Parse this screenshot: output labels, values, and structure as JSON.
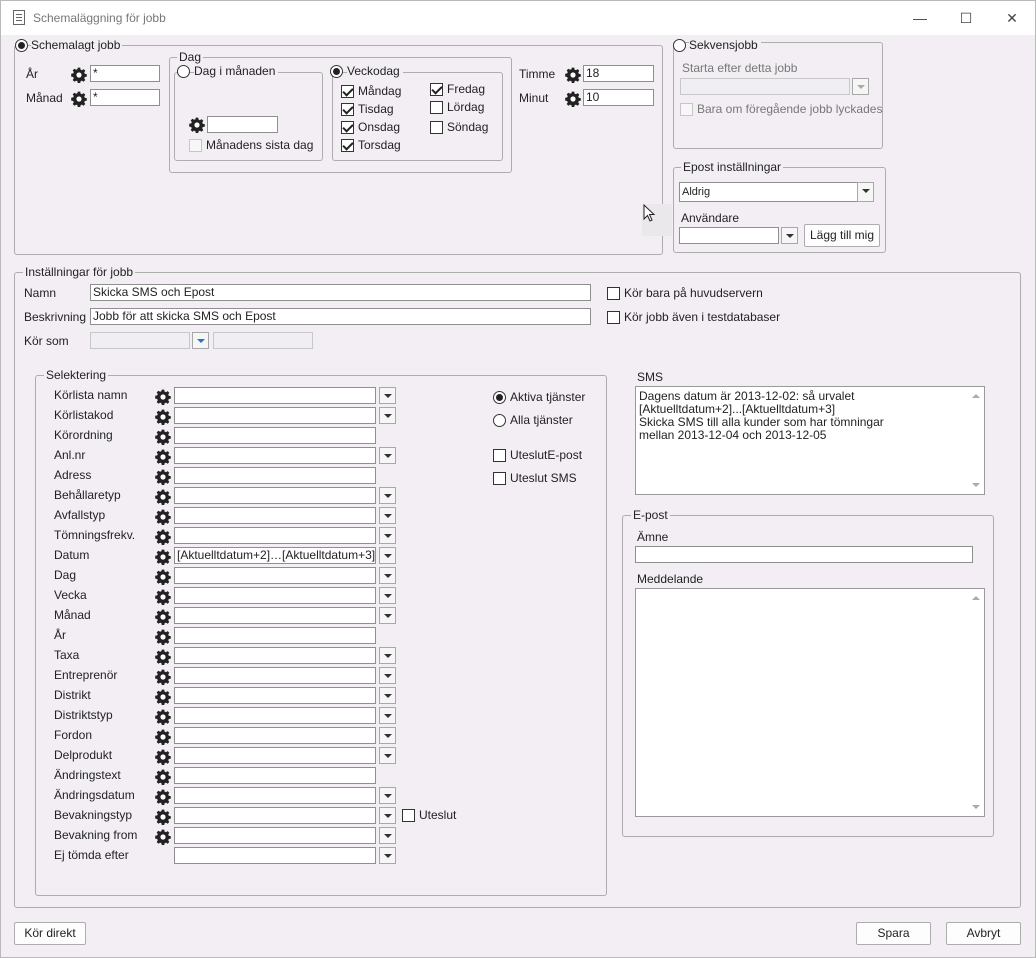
{
  "window": {
    "title": "Schemaläggning för jobb",
    "minimize": "—",
    "maximize": "☐",
    "close": "✕"
  },
  "schedule": {
    "scheduled_label": "Schemalagt jobb",
    "year_label": "År",
    "year_value": "*",
    "month_label": "Månad",
    "month_value": "*",
    "day_group": "Dag",
    "day_of_month_label": "Dag i månaden",
    "day_of_month_value": "",
    "last_day_label": "Månadens sista dag",
    "weekday_label": "Veckodag",
    "days": {
      "mon": "Måndag",
      "tue": "Tisdag",
      "wed": "Onsdag",
      "thu": "Torsdag",
      "fri": "Fredag",
      "sat": "Lördag",
      "sun": "Söndag"
    },
    "hour_label": "Timme",
    "hour_value": "18",
    "minute_label": "Minut",
    "minute_value": "10"
  },
  "sequence": {
    "label": "Sekvensjobb",
    "start_after_label": "Starta efter detta jobb",
    "start_after_value": "",
    "only_if_success_label": "Bara om föregående jobb lyckades"
  },
  "email_settings": {
    "group": "Epost inställningar",
    "send_value": "Aldrig",
    "user_label": "Användare",
    "user_value": "",
    "add_me": "Lägg till mig"
  },
  "job_settings": {
    "group": "Inställningar för jobb",
    "name_label": "Namn",
    "name_value": "Skicka SMS och Epost",
    "desc_label": "Beskrivning",
    "desc_value": "Jobb för att skicka SMS och Epost",
    "run_as_label": "Kör som",
    "run_as_value": "",
    "run_as_extra": "",
    "main_server_only": "Kör bara på huvudservern",
    "run_in_test": "Kör jobb även i testdatabaser"
  },
  "selection": {
    "group": "Selektering",
    "rows": [
      {
        "label": "Körlista namn",
        "value": ""
      },
      {
        "label": "Körlistakod",
        "value": ""
      },
      {
        "label": "Körordning",
        "value": ""
      },
      {
        "label": "Anl.nr",
        "value": ""
      },
      {
        "label": "Adress",
        "value": ""
      },
      {
        "label": "Behållaretyp",
        "value": ""
      },
      {
        "label": "Avfallstyp",
        "value": ""
      },
      {
        "label": "Tömningsfrekv.",
        "value": ""
      },
      {
        "label": "Datum",
        "value": "[Aktuelltdatum+2]…[Aktuelltdatum+3]"
      },
      {
        "label": "Dag",
        "value": ""
      },
      {
        "label": "Vecka",
        "value": ""
      },
      {
        "label": "Månad",
        "value": ""
      },
      {
        "label": "År",
        "value": ""
      },
      {
        "label": "Taxa",
        "value": ""
      },
      {
        "label": "Entreprenör",
        "value": ""
      },
      {
        "label": "Distrikt",
        "value": ""
      },
      {
        "label": "Distriktstyp",
        "value": ""
      },
      {
        "label": "Fordon",
        "value": ""
      },
      {
        "label": "Delprodukt",
        "value": ""
      },
      {
        "label": "Ändringstext",
        "value": ""
      },
      {
        "label": "Ändringsdatum",
        "value": ""
      },
      {
        "label": "Bevakningstyp",
        "value": ""
      },
      {
        "label": "Bevakning from",
        "value": ""
      },
      {
        "label": "Ej tömda efter",
        "value": ""
      }
    ],
    "exclude_label": "Uteslut",
    "active_services": "Aktiva tjänster",
    "all_services": "Alla tjänster",
    "exclude_email": "UteslutE-post",
    "exclude_sms": "Uteslut SMS"
  },
  "sms": {
    "label": "SMS",
    "lines": [
      "Dagens datum är 2013-12-02: så urvalet",
      "[Aktuelltdatum+2]...[Aktuelltdatum+3]",
      "Skicka SMS till alla kunder som har tömningar",
      "mellan 2013-12-04 och 2013-12-05"
    ]
  },
  "email": {
    "group": "E-post",
    "subject_label": "Ämne",
    "subject_value": "",
    "message_label": "Meddelande",
    "message_value": ""
  },
  "footer": {
    "run_now": "Kör direkt",
    "save": "Spara",
    "cancel": "Avbryt"
  }
}
